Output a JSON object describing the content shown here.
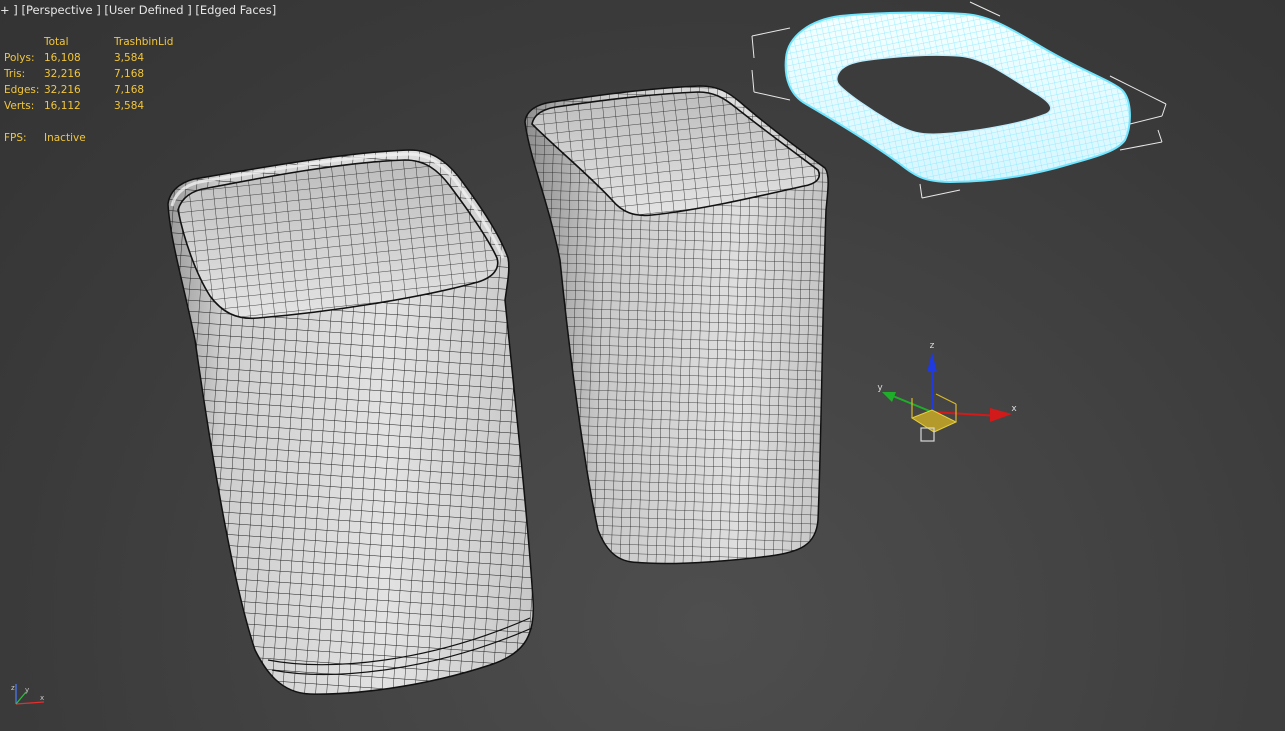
{
  "viewport": {
    "menu_plus": "+",
    "menu_perspective": "Perspective",
    "menu_user_defined": "User Defined",
    "menu_shading": "Edged Faces"
  },
  "stats": {
    "header_total": "Total",
    "header_selected": "TrashbinLid",
    "rows": [
      {
        "label": "Polys:",
        "total": "16,108",
        "selected": "3,584"
      },
      {
        "label": "Tris:",
        "total": "32,216",
        "selected": "7,168"
      },
      {
        "label": "Edges:",
        "total": "32,216",
        "selected": "7,168"
      },
      {
        "label": "Verts:",
        "total": "16,112",
        "selected": "3,584"
      }
    ],
    "fps_label": "FPS:",
    "fps_value": "Inactive"
  },
  "gizmo": {
    "x_label": "x",
    "y_label": "y",
    "z_label": "z"
  },
  "colors": {
    "stats_text": "#f2c63a",
    "selection_highlight": "#6fe6ff",
    "mesh_fill": "#d9d9d9",
    "wire": "#1a1a1a",
    "axis_x": "#d21a1a",
    "axis_y": "#1fae2a",
    "axis_z": "#1f3ae0"
  }
}
